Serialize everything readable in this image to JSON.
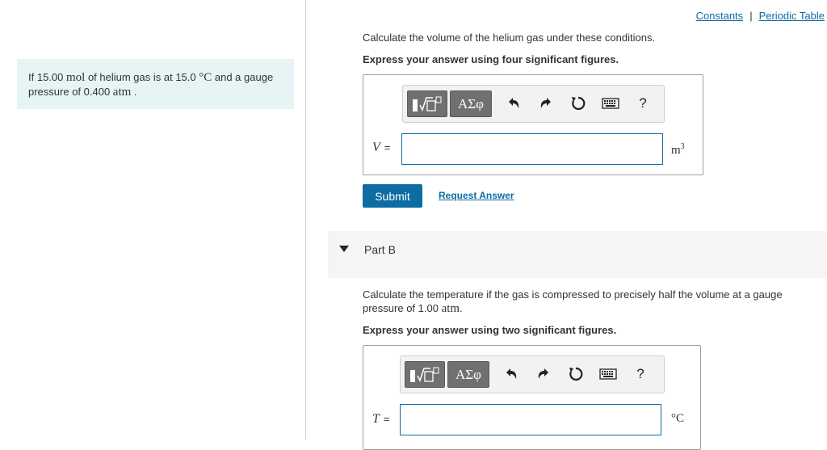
{
  "header": {
    "constants_link": "Constants",
    "separator": "|",
    "periodic_table_link": "Periodic Table"
  },
  "problem": {
    "text_1": "If 15.00 ",
    "unit_mol": "mol",
    "text_2": " of helium gas is at 15.0 ",
    "unit_degC": "°C",
    "text_3": " and a gauge pressure of 0.400 ",
    "unit_atm": "atm",
    "text_4": " ."
  },
  "part_a": {
    "question": "Calculate the volume of the helium gas under these conditions.",
    "instruction": "Express your answer using four significant figures.",
    "variable": "V",
    "equals": "=",
    "input_value": "",
    "unit_base": "m",
    "unit_exp": "3",
    "submit_label": "Submit",
    "request_answer_label": "Request Answer"
  },
  "toolbar": {
    "templates_label": "√□",
    "greek_label": "ΑΣφ",
    "undo_icon": "undo-icon",
    "redo_icon": "redo-icon",
    "reset_icon": "reset-icon",
    "keyboard_icon": "keyboard-icon",
    "help_label": "?"
  },
  "part_b": {
    "label": "Part B",
    "question_1": "Calculate the temperature if the gas is compressed to precisely half the volume at a gauge",
    "question_2a": "pressure of 1.00 ",
    "question_unit": "atm",
    "question_2b": ".",
    "instruction": "Express your answer using two significant figures.",
    "variable": "T",
    "equals": "=",
    "input_value": "",
    "unit": "°C"
  },
  "colors": {
    "accent": "#0d6ca2",
    "problem_bg": "#e6f4f5",
    "toolbar_button": "#707070"
  }
}
